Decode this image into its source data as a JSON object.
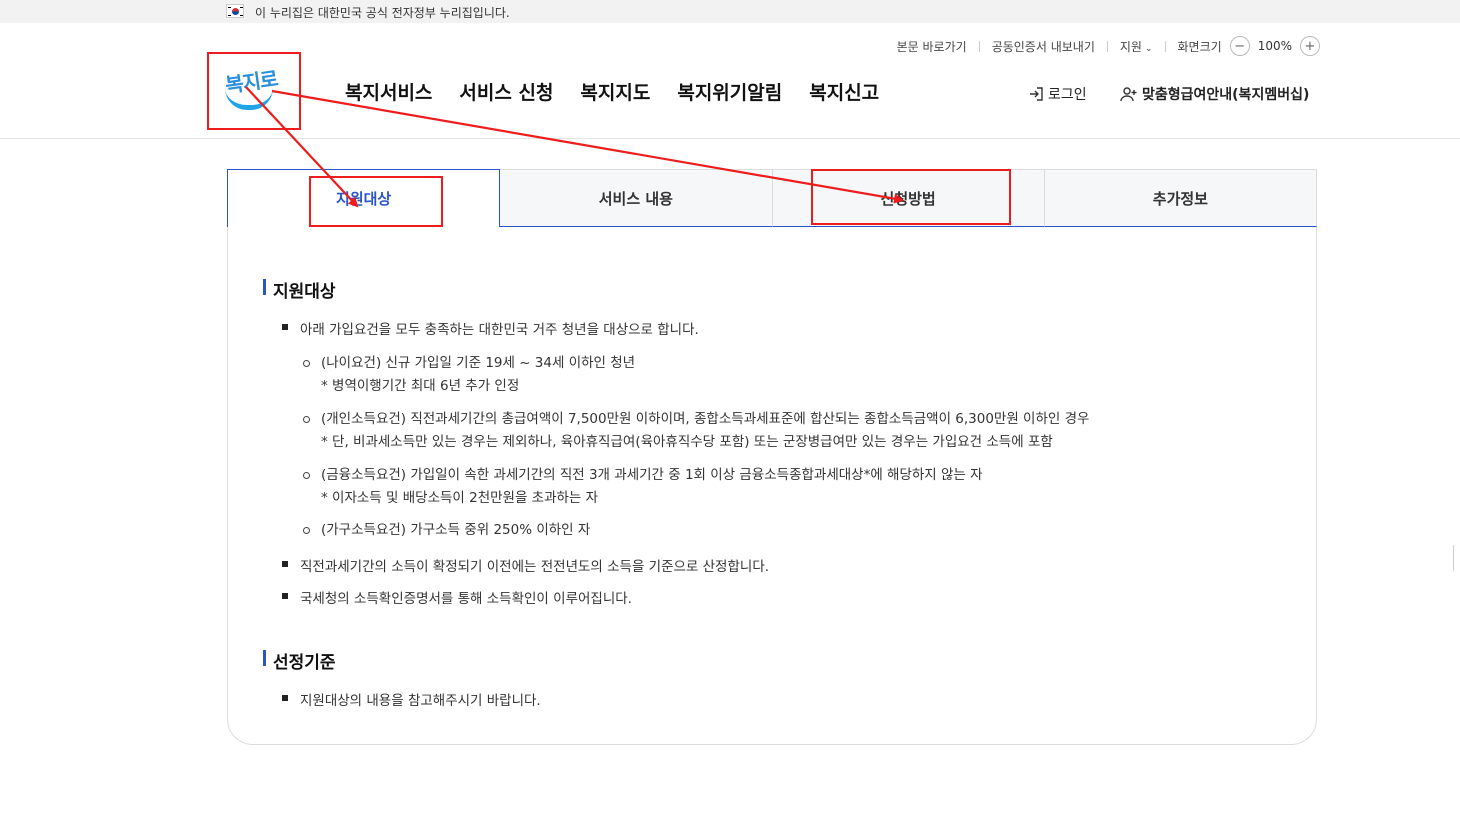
{
  "gov_banner": {
    "text": "이 누리집은 대한민국 공식 전자정부 누리집입니다.",
    "flag_icon": "korea-flag-icon"
  },
  "utility": {
    "skip_link": "본문 바로가기",
    "cert_export": "공동인증서 내보내기",
    "support": "지원",
    "screen_size": "화면크기",
    "zoom_level": "100%",
    "zoom_out": "−",
    "zoom_in": "+"
  },
  "logo": {
    "text": "복지로"
  },
  "gnb": {
    "items": [
      "복지서비스",
      "서비스 신청",
      "복지지도",
      "복지위기알림",
      "복지신고"
    ]
  },
  "header_actions": {
    "login": "로그인",
    "membership": "맞춤형급여안내(복지멤버십)"
  },
  "tabs": [
    {
      "label": "지원대상",
      "active": true
    },
    {
      "label": "서비스 내용",
      "active": false
    },
    {
      "label": "신청방법",
      "active": false
    },
    {
      "label": "추가정보",
      "active": false
    }
  ],
  "content": {
    "section1_title": "지원대상",
    "b1": "아래 가입요건을 모두 충족하는 대한민국 거주 청년을 대상으로 합니다.",
    "sub1_l1": "(나이요건) 신규 가입일 기준 19세 ~ 34세 이하인 청년",
    "sub1_l2": "* 병역이행기간 최대 6년 추가 인정",
    "sub2_l1": "(개인소득요건) 직전과세기간의 총급여액이 7,500만원 이하이며, 종합소득과세표준에 합산되는 종합소득금액이 6,300만원 이하인 경우",
    "sub2_l2": "* 단, 비과세소득만 있는 경우는 제외하나, 육아휴직급여(육아휴직수당 포함) 또는 군장병급여만 있는 경우는 가입요건 소득에 포함",
    "sub3_l1": "(금융소득요건) 가입일이 속한 과세기간의 직전 3개 과세기간 중 1회 이상 금융소득종합과세대상*에 해당하지 않는 자",
    "sub3_l2": "* 이자소득 및 배당소득이 2천만원을 초과하는 자",
    "sub4_l1": "(가구소득요건) 가구소득 중위 250% 이하인 자",
    "b2": "직전과세기간의 소득이 확정되기 이전에는 전전년도의 소득을 기준으로 산정합니다.",
    "b3": "국세청의 소득확인증명서를 통해 소득확인이 이루어집니다.",
    "section2_title": "선정기준",
    "b4": "지원대상의 내용을 참고해주시기 바랍니다."
  },
  "colors": {
    "accent": "#2855c8",
    "annotation": "#ee1c1c",
    "logo_blue": "#2a8fdc"
  }
}
